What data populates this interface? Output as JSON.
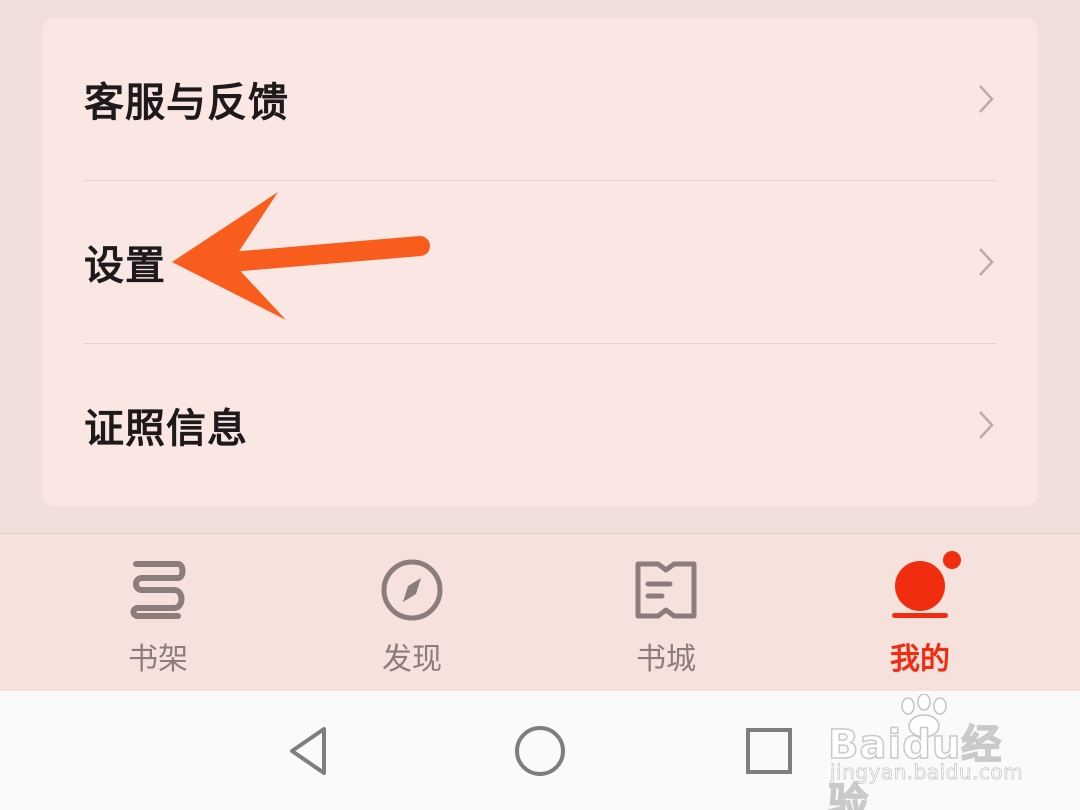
{
  "menu": {
    "items": [
      {
        "label": "客服与反馈"
      },
      {
        "label": "设置"
      },
      {
        "label": "证照信息"
      }
    ]
  },
  "tabbar": {
    "tabs": [
      {
        "label": "书架",
        "icon": "bookshelf-icon",
        "active": false
      },
      {
        "label": "发现",
        "icon": "compass-icon",
        "active": false
      },
      {
        "label": "书城",
        "icon": "open-book-icon",
        "active": false
      },
      {
        "label": "我的",
        "icon": "profile-icon",
        "active": true,
        "badge": true
      }
    ]
  },
  "system_nav": {
    "buttons": [
      "back-triangle-icon",
      "home-circle-icon",
      "recents-square-icon"
    ]
  },
  "watermark": {
    "logo": "Baidu经验",
    "url": "jingyan.baidu.com"
  },
  "colors": {
    "accent": "#f12d10",
    "annotation_arrow": "#f95d1d",
    "inactive": "#8b7d7c"
  }
}
